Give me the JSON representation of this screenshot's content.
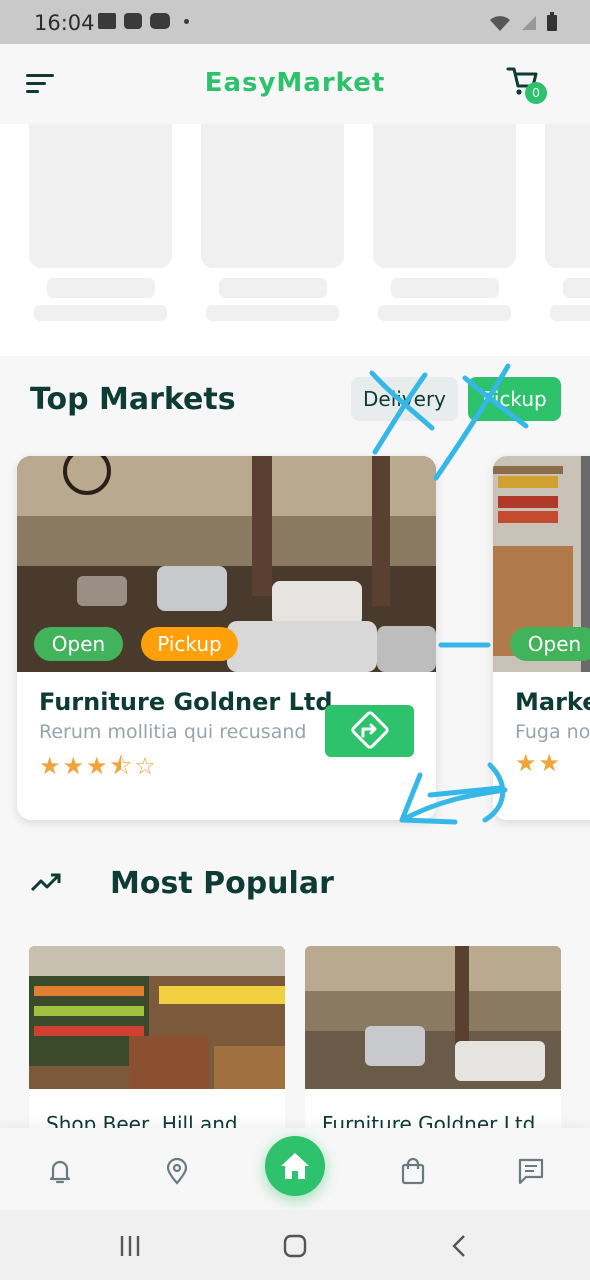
{
  "status_bar": {
    "time": "16:04"
  },
  "app_bar": {
    "title": "EasyMarket",
    "cart_count": "0"
  },
  "top_markets": {
    "title": "Top Markets",
    "filters": [
      "Delivery",
      "Pickup"
    ],
    "active_filter": "Pickup",
    "cards": [
      {
        "name": "Furniture Goldner Ltd",
        "subtitle": "Rerum mollitia qui recusandae",
        "badges": [
          "Open",
          "Pickup"
        ],
        "rating": 3.5,
        "stars": "★★★⯪☆"
      },
      {
        "name": "Market",
        "subtitle": "Fuga non",
        "badges": [
          "Open"
        ],
        "stars": "★★"
      }
    ]
  },
  "most_popular": {
    "title": "Most Popular",
    "items": [
      {
        "name": "Shop Beer, Hill and"
      },
      {
        "name": "Furniture Goldner Ltd"
      }
    ]
  },
  "colors": {
    "accent": "#2dc26b",
    "dark": "#0e3b34",
    "orange": "#ff9f0a",
    "open": "#40b35b"
  }
}
